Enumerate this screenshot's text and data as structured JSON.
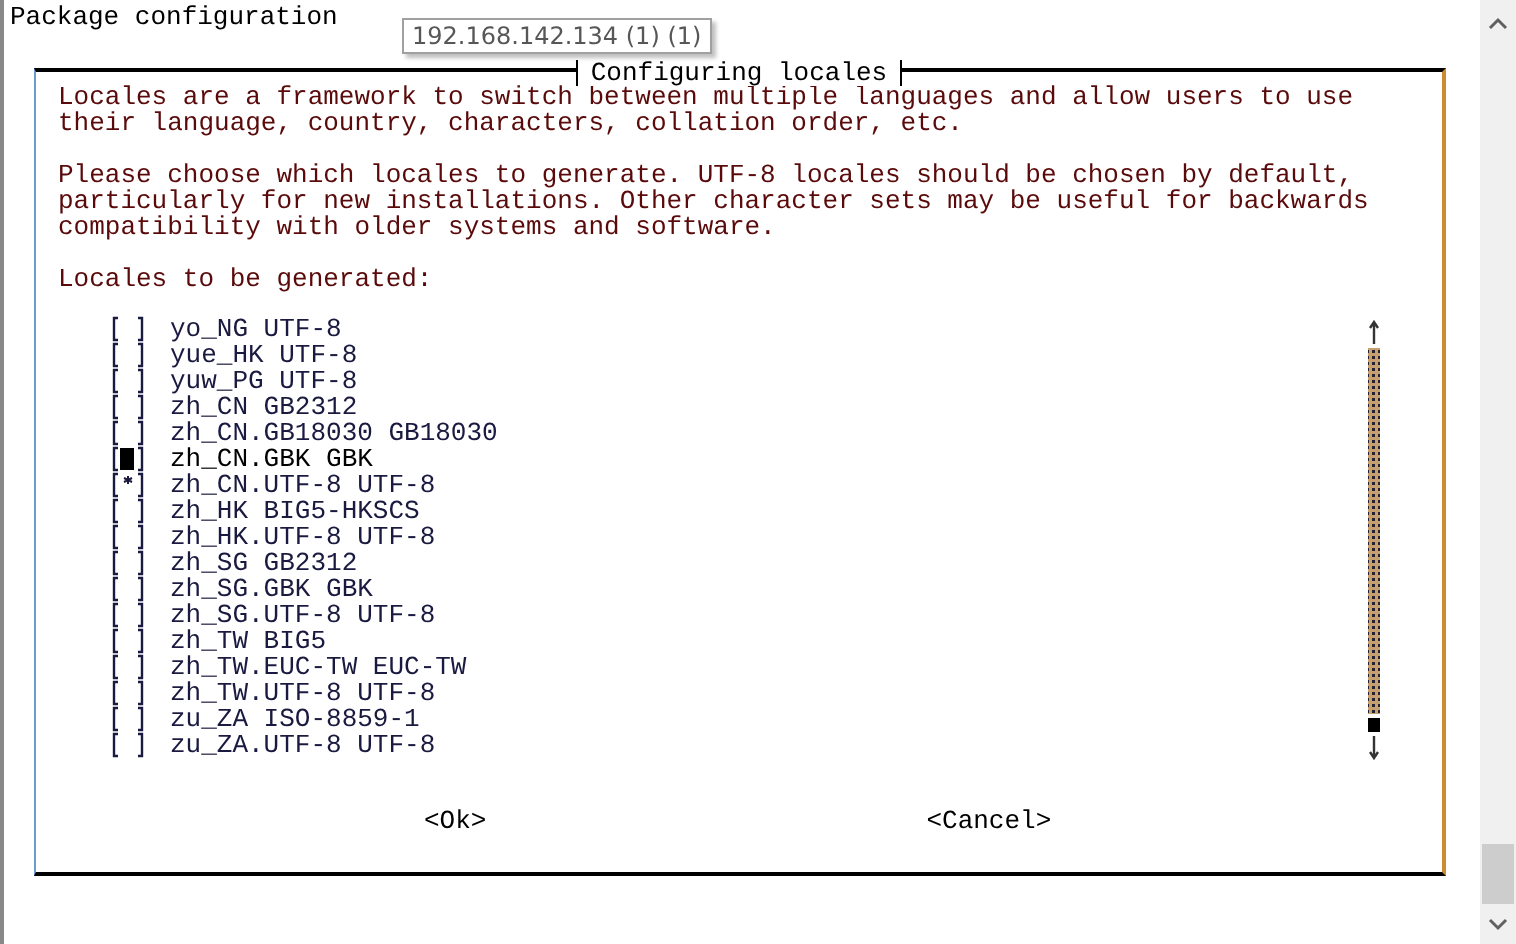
{
  "window": {
    "title": "Package configuration"
  },
  "tooltip": "192.168.142.134 (1) (1)",
  "dialog": {
    "title": "Configuring locales",
    "paragraphs": [
      "Locales are a framework to switch between multiple languages and allow users to use their language, country, characters, collation order, etc.",
      "Please choose which locales to generate. UTF-8 locales should be chosen by default, particularly for new installations. Other character sets may be useful for backwards compatibility with older systems and software."
    ],
    "list_label": "Locales to be generated:",
    "items": [
      {
        "label": "yo_NG UTF-8",
        "checked": false,
        "selected": false
      },
      {
        "label": "yue_HK UTF-8",
        "checked": false,
        "selected": false
      },
      {
        "label": "yuw_PG UTF-8",
        "checked": false,
        "selected": false
      },
      {
        "label": "zh_CN GB2312",
        "checked": false,
        "selected": false
      },
      {
        "label": "zh_CN.GB18030 GB18030",
        "checked": false,
        "selected": false
      },
      {
        "label": "zh_CN.GBK GBK",
        "checked": false,
        "selected": true
      },
      {
        "label": "zh_CN.UTF-8 UTF-8",
        "checked": true,
        "selected": false
      },
      {
        "label": "zh_HK BIG5-HKSCS",
        "checked": false,
        "selected": false
      },
      {
        "label": "zh_HK.UTF-8 UTF-8",
        "checked": false,
        "selected": false
      },
      {
        "label": "zh_SG GB2312",
        "checked": false,
        "selected": false
      },
      {
        "label": "zh_SG.GBK GBK",
        "checked": false,
        "selected": false
      },
      {
        "label": "zh_SG.UTF-8 UTF-8",
        "checked": false,
        "selected": false
      },
      {
        "label": "zh_TW BIG5",
        "checked": false,
        "selected": false
      },
      {
        "label": "zh_TW.EUC-TW EUC-TW",
        "checked": false,
        "selected": false
      },
      {
        "label": "zh_TW.UTF-8 UTF-8",
        "checked": false,
        "selected": false
      },
      {
        "label": "zu_ZA ISO-8859-1",
        "checked": false,
        "selected": false
      },
      {
        "label": "zu_ZA.UTF-8 UTF-8",
        "checked": false,
        "selected": false
      }
    ],
    "buttons": [
      "<Ok>",
      "<Cancel>"
    ]
  }
}
